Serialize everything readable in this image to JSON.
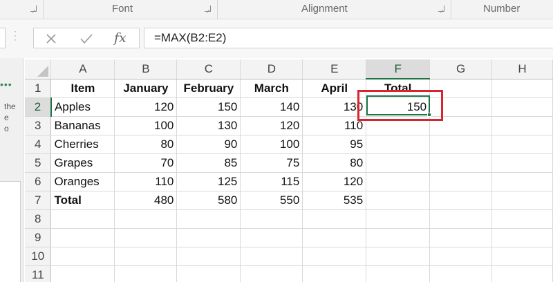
{
  "ribbon": {
    "groups": [
      "Font",
      "Alignment",
      "Number"
    ]
  },
  "formula_bar": {
    "cancel_icon": "close-icon",
    "enter_icon": "checkmark-icon",
    "function_symbol": "fx",
    "formula": "=MAX(B2:E2)"
  },
  "task_pane": {
    "dots": "•••",
    "text_lines": [
      "the",
      "e",
      "o"
    ]
  },
  "sheet": {
    "columns": [
      "A",
      "B",
      "C",
      "D",
      "E",
      "F",
      "G",
      "H"
    ],
    "rows": [
      "1",
      "2",
      "3",
      "4",
      "5",
      "6",
      "7",
      "8",
      "9",
      "10",
      "11"
    ],
    "selected_column": "F",
    "selected_row": "2",
    "header_row": [
      "Item",
      "January",
      "February",
      "March",
      "April",
      "Total"
    ],
    "data": [
      [
        "Apples",
        "120",
        "150",
        "140",
        "130",
        "150"
      ],
      [
        "Bananas",
        "100",
        "130",
        "120",
        "110",
        ""
      ],
      [
        "Cherries",
        "80",
        "90",
        "100",
        "95",
        ""
      ],
      [
        "Grapes",
        "70",
        "85",
        "75",
        "80",
        ""
      ],
      [
        "Oranges",
        "110",
        "125",
        "115",
        "120",
        ""
      ],
      [
        "Total",
        "480",
        "580",
        "550",
        "535",
        ""
      ]
    ]
  },
  "colors": {
    "selection": "#217346",
    "highlight": "#d9232e"
  }
}
